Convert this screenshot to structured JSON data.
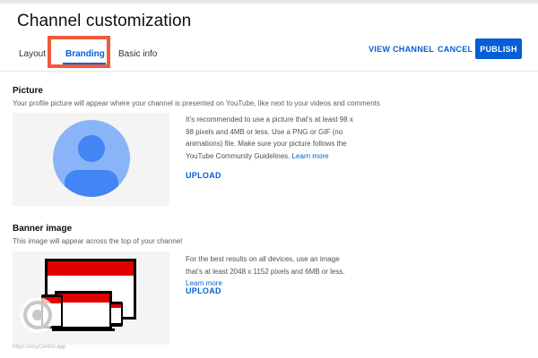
{
  "header": {
    "title": "Channel customization",
    "tabs": [
      {
        "label": "Layout"
      },
      {
        "label": "Branding"
      },
      {
        "label": "Basic info"
      }
    ],
    "view_channel_label": "VIEW CHANNEL",
    "cancel_label": "CANCEL",
    "publish_label": "PUBLISH"
  },
  "picture": {
    "title": "Picture",
    "description": "Your profile picture will appear where your channel is presented on YouTube, like next to your videos and comments",
    "info": "It’s recommended to use a picture that’s at least 98 x 98 pixels and 4MB or less. Use a PNG or GIF (no animations) file. Make sure your picture follows the YouTube Community Guidelines.",
    "learn_more": "Learn more",
    "upload_label": "UPLOAD"
  },
  "banner": {
    "title": "Banner image",
    "description": "This image will appear across the top of your channel",
    "info": "For the best results on all devices, use an image that’s at least 2048 x 1152 pixels and 6MB or less.",
    "learn_more": "Learn more",
    "upload_label": "UPLOAD"
  },
  "watermark": {
    "text": "https://AnyControl.app"
  },
  "colors": {
    "accent": "#065fd4",
    "highlight": "#f05a3a",
    "banner_red": "#e00000",
    "avatar_light": "#8ab4f8",
    "avatar_dark": "#4285f4"
  }
}
